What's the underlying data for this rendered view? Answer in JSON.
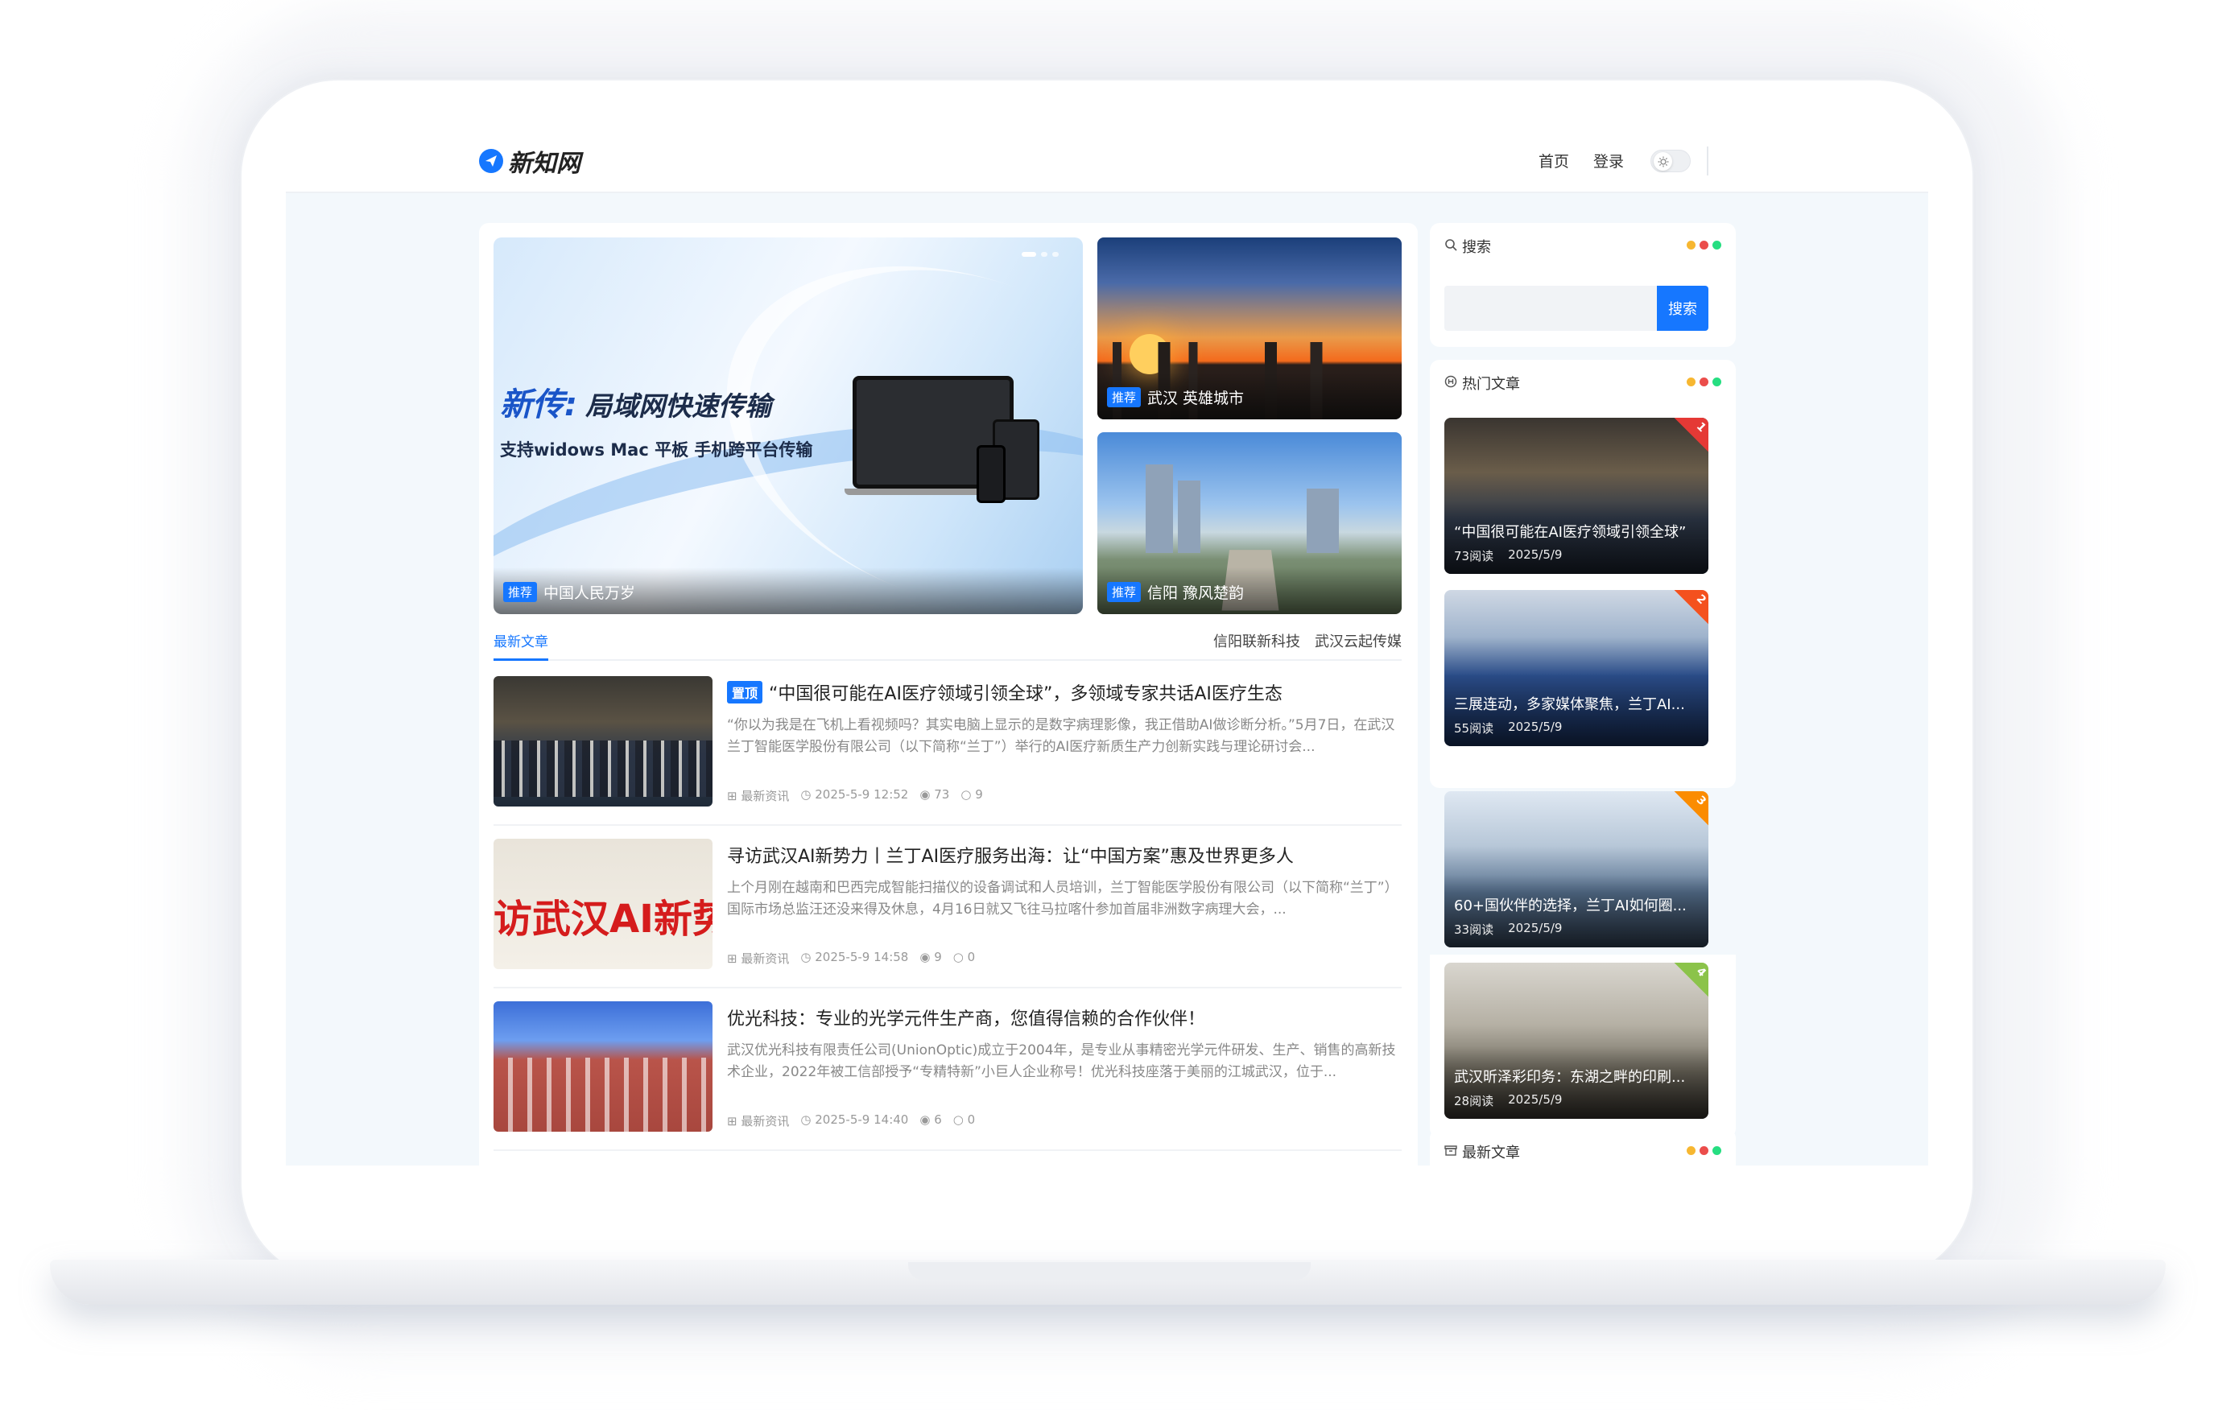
{
  "site": {
    "logo_text": "新知网"
  },
  "nav": {
    "home": "首页",
    "login": "登录"
  },
  "slider": {
    "headline_accent": "新传:",
    "headline_rest": "局域网快速传输",
    "subline": "支持widows Mac 平板 手机跨平台传输",
    "tag": "推荐",
    "caption": "中国人民万岁"
  },
  "side_images": [
    {
      "tag": "推荐",
      "caption": "武汉 英雄城市"
    },
    {
      "tag": "推荐",
      "caption": "信阳 豫风楚韵"
    }
  ],
  "tabs": {
    "active": "最新文章",
    "links": [
      "信阳联新科技",
      "武汉云起传媒"
    ]
  },
  "articles": [
    {
      "pinned": "置顶",
      "title": "“中国很可能在AI医疗领域引领全球”，多领域专家共话AI医疗生态",
      "excerpt": "“你以为我是在飞机上看视频吗？其实电脑上显示的是数字病理影像，我正借助AI做诊断分析。”5月7日，在武汉兰丁智能医学股份有限公司（以下简称“兰丁”）举行的AI医疗新质生产力创新实践与理论研讨会...",
      "category": "最新资讯",
      "date": "2025-5-9 12:52",
      "views": "73",
      "comments": "9"
    },
    {
      "pinned": "",
      "title": "寻访武汉AI新势力丨兰丁AI医疗服务出海：让“中国方案”惠及世界更多人",
      "excerpt": "上个月刚在越南和巴西完成智能扫描仪的设备调试和人员培训，兰丁智能医学股份有限公司（以下简称“兰丁”）国际市场总监汪还没来得及休息，4月16日就又飞往马拉喀什参加首届非洲数字病理大会，...",
      "category": "最新资讯",
      "date": "2025-5-9 14:58",
      "views": "9",
      "comments": "0",
      "thumb_text": "访武汉AI新势"
    },
    {
      "pinned": "",
      "title": "优光科技：专业的光学元件生产商，您值得信赖的合作伙伴！",
      "excerpt": "武汉优光科技有限责任公司(UnionOptic)成立于2004年，是专业从事精密光学元件研发、生产、销售的高新技术企业，2022年被工信部授予“专精特新”小巨人企业称号！优光科技座落于美丽的江城武汉，位于...",
      "category": "最新资讯",
      "date": "2025-5-9 14:40",
      "views": "6",
      "comments": "0"
    }
  ],
  "search": {
    "header": "搜索",
    "placeholder": "",
    "button": "搜索"
  },
  "hot": {
    "header": "热门文章",
    "items": [
      {
        "rank": "1",
        "title": "“中国很可能在AI医疗领域引领全球”",
        "reads": "73阅读",
        "date": "2025/5/9"
      },
      {
        "rank": "2",
        "title": "三展连动，多家媒体聚焦，兰丁AI...",
        "reads": "55阅读",
        "date": "2025/5/9"
      },
      {
        "rank": "3",
        "title": "60+国伙伴的选择，兰丁AI如何圈...",
        "reads": "33阅读",
        "date": "2025/5/9"
      },
      {
        "rank": "4",
        "title": "武汉昕泽彩印务：东湖之畔的印刷...",
        "reads": "28阅读",
        "date": "2025/5/9"
      }
    ]
  },
  "latest_widget": {
    "header": "最新文章"
  },
  "colors": {
    "accent": "#1677ff",
    "dot_yellow": "#f7b731",
    "dot_red": "#eb4d4b",
    "dot_green": "#26de81",
    "rank1": "#e53935",
    "rank2": "#f4511e",
    "rank3": "#fb8c00",
    "rank4": "#8bc34a"
  }
}
